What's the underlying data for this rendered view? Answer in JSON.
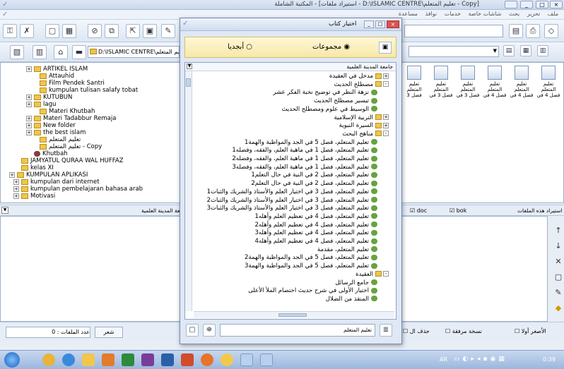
{
  "window": {
    "title": "[Copy - تعليم المتعلم\\D:\\ISLAMIC CENTRE - استيراد ملفات] - المكتبة الشاملة",
    "menu": [
      "ملف",
      "تحرير",
      "بحث",
      "شاشات خاصة",
      "خدمات",
      "نوافذ",
      "مساعدة"
    ]
  },
  "toolbar2": {
    "path": "D:\\ISLAMIC CENTRE\\تعليم المتعلم"
  },
  "tree": {
    "items": [
      {
        "label": "ARTIKEL ISLAM",
        "exp": "+"
      },
      {
        "label": "Attauhid",
        "exp": ""
      },
      {
        "label": "Film Pendek Santri",
        "exp": ""
      },
      {
        "label": "kumpulan tulisan salafy tobat",
        "exp": ""
      },
      {
        "label": "KUTUBUN",
        "exp": "+"
      },
      {
        "label": "lagu",
        "exp": "+"
      },
      {
        "label": "Materi Khutbah",
        "exp": ""
      },
      {
        "label": "Materi Tadabbur Remaja",
        "exp": "+"
      },
      {
        "label": "New folder",
        "exp": "+"
      },
      {
        "label": "the best islam",
        "exp": "+"
      },
      {
        "label": "تعليم المتعلم",
        "exp": ""
      },
      {
        "label": "تعليم المتعلم - Copy",
        "exp": ""
      },
      {
        "label": "Khutbah",
        "exp": "",
        "book": true
      },
      {
        "label": "JAMYATUL QURAA WAL HUFFAZ",
        "exp": ""
      },
      {
        "label": "kelas XI",
        "exp": ""
      },
      {
        "label": "KUMPULAN APLIKASI",
        "exp": "+"
      },
      {
        "label": "kumpulan dari internet",
        "exp": "+"
      },
      {
        "label": "kumpulan pembelajaran bahasa arab",
        "exp": "+"
      },
      {
        "label": "Motivasi",
        "exp": "+"
      }
    ]
  },
  "files": {
    "items": [
      {
        "line1": "تعليم المتعلم",
        "line2": "فصل 4 في"
      },
      {
        "line1": "تعليم المتعلم",
        "line2": "فصل 4 في"
      },
      {
        "line1": "تعليم المتعلم",
        "line2": "فصل 4 في"
      },
      {
        "line1": "تعليم المتعلم",
        "line2": "فصل 3 في"
      },
      {
        "line1": "تعليم المتعلم",
        "line2": "فصل 3 في"
      },
      {
        "line1": "تعليم المتعلم",
        "line2": "فصل 3"
      }
    ]
  },
  "middle": {
    "left_label": "جامعة المدينة العلمية",
    "filter_doc": "doc",
    "filter_bok": "bok",
    "import_label": "استيراد هذه الملفات"
  },
  "status": {
    "count_label": "عدد الملفات : 0",
    "poetry_btn": "شعر",
    "delete_label": "حذف ال",
    "copy_label": "نسخة مرفقة",
    "smaller_label": "الأصغر أولا"
  },
  "dialog": {
    "title": "اختيار كتاب",
    "radio_groups": "مجموعات",
    "radio_alpha": "أبجديا",
    "header": "جامعة المدينة العلمية",
    "search_label": "تعليم المتعلم",
    "items": [
      {
        "t": "مدخل في العقيدة",
        "lvl": 0,
        "kind": "folder",
        "exp": "+"
      },
      {
        "t": "مصطلح الحديث",
        "lvl": 0,
        "kind": "folder",
        "exp": "-"
      },
      {
        "t": "نزهة النظر في توضيح نخبة الفكر عشر",
        "lvl": 1,
        "kind": "book"
      },
      {
        "t": "تيسير مصطلح الحديث",
        "lvl": 1,
        "kind": "book"
      },
      {
        "t": "الوسيط في علوم ومصطلح الحديث",
        "lvl": 1,
        "kind": "book"
      },
      {
        "t": "التربية الإسلامية",
        "lvl": 0,
        "kind": "folder",
        "exp": "+"
      },
      {
        "t": "السيرة النبوية",
        "lvl": 0,
        "kind": "folder",
        "exp": "+"
      },
      {
        "t": "مناهج البحث",
        "lvl": 0,
        "kind": "folder",
        "exp": "-"
      },
      {
        "t": "تعليم المتعلم، فصل 5 في الجد والمواظبة والهمة1",
        "lvl": 1,
        "kind": "book"
      },
      {
        "t": "تعليم المتعلم، فصل 1 في ماهية العلم، والفقه، وفضله1",
        "lvl": 1,
        "kind": "book"
      },
      {
        "t": "تعليم المتعلم، فصل 1 في ماهية العلم، والفقه، وفضله2",
        "lvl": 1,
        "kind": "book"
      },
      {
        "t": "تعليم المتعلم، فصل 1 في ماهية العلم، والفقه، وفضله3",
        "lvl": 1,
        "kind": "book"
      },
      {
        "t": "تعليم المتعلم، فصل 2 في النية في حال التعلم1",
        "lvl": 1,
        "kind": "book"
      },
      {
        "t": "تعليم المتعلم، فصل 2 في النية في حال التعلم2",
        "lvl": 1,
        "kind": "book"
      },
      {
        "t": "تعليم المتعلم، فصل 3 في اختيار العلم والأستاذ والشريك والثبات1",
        "lvl": 1,
        "kind": "book"
      },
      {
        "t": "تعليم المتعلم، فصل 3 في اختيار العلم والأستاذ والشريك والثبات2",
        "lvl": 1,
        "kind": "book"
      },
      {
        "t": "تعليم المتعلم، فصل 3 في اختيار العلم والأستاذ والشريك والثبات3",
        "lvl": 1,
        "kind": "book"
      },
      {
        "t": "تعليم المتعلم، فصل 4 في تعظيم العلم وأهله1",
        "lvl": 1,
        "kind": "book"
      },
      {
        "t": "تعليم المتعلم، فصل 4 في تعظيم العلم وأهله2",
        "lvl": 1,
        "kind": "book"
      },
      {
        "t": "تعليم المتعلم، فصل 4 في تعظيم العلم وأهله3",
        "lvl": 1,
        "kind": "book"
      },
      {
        "t": "تعليم المتعلم، فصل 4 في تعظيم العلم وأهله4",
        "lvl": 1,
        "kind": "book"
      },
      {
        "t": "تعليم المتعلم، مقدمة",
        "lvl": 1,
        "kind": "book"
      },
      {
        "t": "تعليم المتعلم، فصل 5 في الجد والمواظبة والهمة2",
        "lvl": 1,
        "kind": "book"
      },
      {
        "t": "تعليم المتعلم، فصل 5 في الجد والمواظبة والهمة3",
        "lvl": 1,
        "kind": "book"
      },
      {
        "t": "العقيدة",
        "lvl": 0,
        "kind": "folder",
        "exp": "-"
      },
      {
        "t": "جامع الرسائل",
        "lvl": 1,
        "kind": "book"
      },
      {
        "t": "اختيار الأولى في شرح حديث اختصام الملأ الأعلى",
        "lvl": 1,
        "kind": "book"
      },
      {
        "t": "المنقذ من الضلال",
        "lvl": 1,
        "kind": "book"
      }
    ]
  },
  "taskbar": {
    "lang": "AR",
    "time": "0:39"
  },
  "colors": {
    "accent": "#6e8bb5",
    "folder": "#efc64c",
    "book": "#67a33f",
    "close": "#d9534f"
  }
}
